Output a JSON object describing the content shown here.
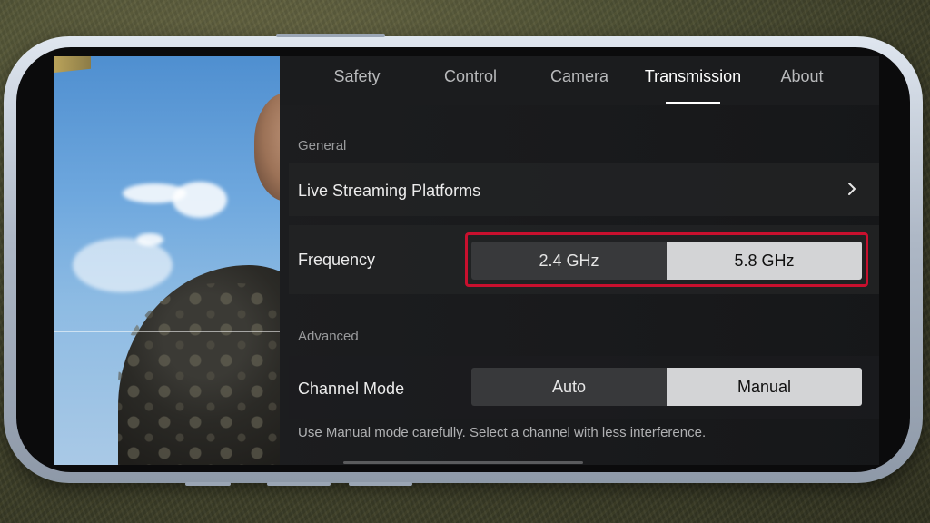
{
  "tabs": [
    {
      "label": "Safety",
      "active": false
    },
    {
      "label": "Control",
      "active": false
    },
    {
      "label": "Camera",
      "active": false
    },
    {
      "label": "Transmission",
      "active": true
    },
    {
      "label": "About",
      "active": false
    }
  ],
  "general": {
    "section_label": "General",
    "live_streaming": {
      "label": "Live Streaming Platforms",
      "icon": "chevron-right-icon"
    },
    "frequency": {
      "label": "Frequency",
      "options": [
        "2.4 GHz",
        "5.8 GHz"
      ],
      "selected": "5.8 GHz",
      "highlight_color": "#c8102e"
    }
  },
  "advanced": {
    "section_label": "Advanced",
    "channel_mode": {
      "label": "Channel Mode",
      "options": [
        "Auto",
        "Manual"
      ],
      "selected": "Manual"
    },
    "hint": "Use Manual mode carefully. Select a channel with less interference."
  },
  "colors": {
    "panel_bg": "#1c1d1f",
    "selected_segment": "#d3d4d6",
    "unselected_segment": "#38393b",
    "highlight": "#c8102e"
  }
}
